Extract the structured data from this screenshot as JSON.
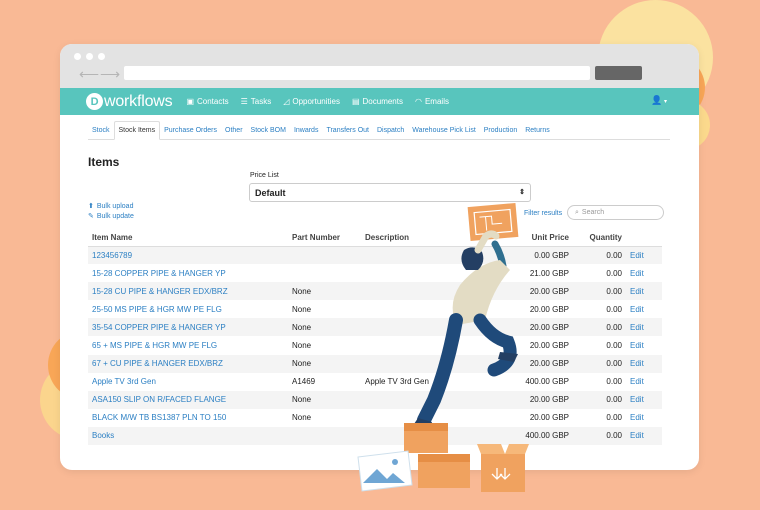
{
  "app": {
    "logo_letter": "D",
    "logo_text": "workflows",
    "nav": [
      {
        "label": "Contacts",
        "icon": "contacts-card-icon"
      },
      {
        "label": "Tasks",
        "icon": "tasks-list-icon"
      },
      {
        "label": "Opportunities",
        "icon": "chart-icon"
      },
      {
        "label": "Documents",
        "icon": "document-icon"
      },
      {
        "label": "Emails",
        "icon": "headset-icon"
      }
    ],
    "user_menu_icon": "user-icon"
  },
  "tabs": [
    "Stock",
    "Stock Items",
    "Purchase Orders",
    "Other",
    "Stock BOM",
    "Inwards",
    "Transfers Out",
    "Dispatch",
    "Warehouse Pick List",
    "Production",
    "Returns"
  ],
  "active_tab": "Stock Items",
  "page": {
    "title": "Items",
    "price_list_label": "Price List",
    "price_list_value": "Default",
    "bulk_upload": "Bulk upload",
    "bulk_update": "Bulk update",
    "filter_results": "Filter results",
    "search_placeholder": "Search"
  },
  "table": {
    "headers": [
      "Item Name",
      "Part Number",
      "Description",
      "Unit Price",
      "Quantity",
      ""
    ],
    "rows": [
      {
        "name": "123456789",
        "part": "",
        "desc": "",
        "price": "0.00 GBP",
        "qty": "0.00",
        "action": "Edit"
      },
      {
        "name": "15-28 COPPER PIPE & HANGER YP",
        "part": "",
        "desc": "",
        "price": "21.00 GBP",
        "qty": "0.00",
        "action": "Edit"
      },
      {
        "name": "15-28 CU PIPE & HANGER EDX/BRZ",
        "part": "None",
        "desc": "",
        "price": "20.00 GBP",
        "qty": "0.00",
        "action": "Edit"
      },
      {
        "name": "25-50 MS PIPE & HGR MW PE FLG",
        "part": "None",
        "desc": "",
        "price": "20.00 GBP",
        "qty": "0.00",
        "action": "Edit"
      },
      {
        "name": "35-54 COPPER PIPE & HANGER YP",
        "part": "None",
        "desc": "",
        "price": "20.00 GBP",
        "qty": "0.00",
        "action": "Edit"
      },
      {
        "name": "65 + MS PIPE & HGR MW PE FLG",
        "part": "None",
        "desc": "",
        "price": "20.00 GBP",
        "qty": "0.00",
        "action": "Edit"
      },
      {
        "name": "67 + CU PIPE & HANGER EDX/BRZ",
        "part": "None",
        "desc": "",
        "price": "20.00 GBP",
        "qty": "0.00",
        "action": "Edit"
      },
      {
        "name": "Apple TV 3rd Gen",
        "part": "A1469",
        "desc": "Apple TV 3rd Gen",
        "price": "400.00 GBP",
        "qty": "0.00",
        "action": "Edit"
      },
      {
        "name": "ASA150 SLIP ON R/FACED FLANGE",
        "part": "None",
        "desc": "",
        "price": "20.00 GBP",
        "qty": "0.00",
        "action": "Edit"
      },
      {
        "name": "BLACK M/W TB BS1387 PLN TO 150",
        "part": "None",
        "desc": "",
        "price": "20.00 GBP",
        "qty": "0.00",
        "action": "Edit"
      },
      {
        "name": "Books",
        "part": "",
        "desc": "",
        "price": "400.00 GBP",
        "qty": "0.00",
        "action": "Edit"
      }
    ]
  },
  "colors": {
    "background": "#f9b995",
    "appbar": "#58c5bd",
    "link": "#2b7fc3",
    "box": "#f0a25f"
  }
}
